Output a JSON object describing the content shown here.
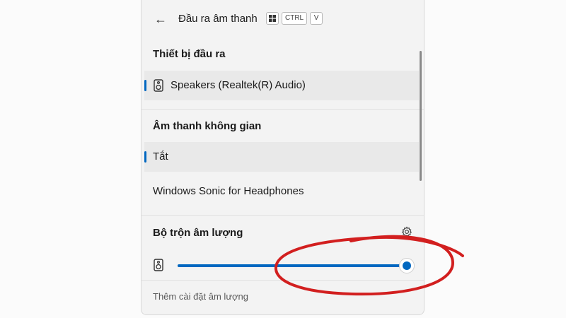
{
  "header": {
    "title": "Đầu ra âm thanh",
    "shortcut": {
      "icon": "windows-key-icon",
      "keys": [
        "CTRL",
        "V"
      ]
    }
  },
  "output_devices": {
    "heading": "Thiết bị đầu ra",
    "items": [
      {
        "label": "Speakers (Realtek(R) Audio)",
        "icon": "speaker-icon",
        "selected": true
      }
    ]
  },
  "spatial_sound": {
    "heading": "Âm thanh không gian",
    "items": [
      {
        "label": "Tắt",
        "selected": true
      },
      {
        "label": "Windows Sonic for Headphones",
        "selected": false
      }
    ]
  },
  "volume_mixer": {
    "heading": "Bộ trộn âm lượng",
    "settings_icon": "gear-icon",
    "device_icon": "speaker-icon",
    "volume_fraction": 1.0
  },
  "footer": {
    "link": "Thêm cài đặt âm lượng"
  },
  "colors": {
    "accent": "#0067c0",
    "annotation": "#d21f1f",
    "panel": "#f3f3f3"
  }
}
